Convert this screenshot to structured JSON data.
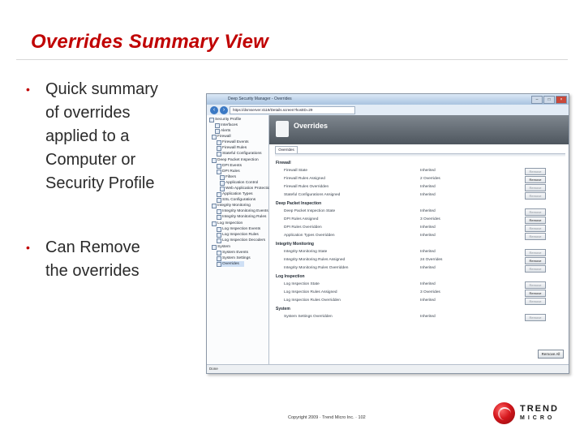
{
  "slide": {
    "title": "Overrides Summary View",
    "bullets": [
      {
        "symbol": "•",
        "text": "Quick summary\nof overrides\napplied to a\nComputer or\nSecurity Profile"
      },
      {
        "symbol": "•",
        "text": "Can Remove\nthe overrides"
      }
    ],
    "footer": "Copyright 2009 · Trend Micro Inc. · 102",
    "logo": {
      "word": "TREND",
      "sub": "MICRO"
    }
  },
  "screenshot": {
    "window_title": "Deep Security Manager - Overrides",
    "address": "https://dsmserver:4119/Details.screen?hostID=29",
    "controls": {
      "minimize": "–",
      "maximize": "□",
      "close": "×"
    },
    "tree": [
      {
        "label": "Security Profile",
        "icon": "profile-icon"
      },
      {
        "label": "Interfaces",
        "icon": "interfaces-icon"
      },
      {
        "label": "Alerts",
        "icon": "alerts-icon"
      },
      {
        "label": "Firewall",
        "icon": "firewall-icon"
      },
      {
        "label": "Firewall Events",
        "icon": "events-icon"
      },
      {
        "label": "Firewall Rules",
        "icon": "rules-icon"
      },
      {
        "label": "Stateful Configurations",
        "icon": "config-icon"
      },
      {
        "label": "Deep Packet Inspection",
        "icon": "dpi-icon"
      },
      {
        "label": "DPI Events",
        "icon": "events-icon"
      },
      {
        "label": "DPI Rules",
        "icon": "rules-icon"
      },
      {
        "label": "Filters",
        "icon": "filter-icon"
      },
      {
        "label": "Application Control",
        "icon": "app-icon"
      },
      {
        "label": "Web Application Protection",
        "icon": "web-icon"
      },
      {
        "label": "Application Types",
        "icon": "types-icon"
      },
      {
        "label": "SSL Configurations",
        "icon": "ssl-icon"
      },
      {
        "label": "Integrity Monitoring",
        "icon": "integrity-icon"
      },
      {
        "label": "Integrity Monitoring Events",
        "icon": "events-icon"
      },
      {
        "label": "Integrity Monitoring Rules",
        "icon": "rules-icon"
      },
      {
        "label": "Log Inspection",
        "icon": "log-icon"
      },
      {
        "label": "Log Inspection Events",
        "icon": "events-icon"
      },
      {
        "label": "Log Inspection Rules",
        "icon": "rules-icon"
      },
      {
        "label": "Log Inspection Decoders",
        "icon": "decoder-icon"
      },
      {
        "label": "System",
        "icon": "system-icon"
      },
      {
        "label": "System Events",
        "icon": "events-icon"
      },
      {
        "label": "System Settings",
        "icon": "settings-icon"
      },
      {
        "label": "Overrides",
        "icon": "overrides-icon"
      }
    ],
    "header_title": "Overrides",
    "tab_label": "Overrides",
    "sections": [
      {
        "title": "Firewall",
        "rows": [
          {
            "name": "Firewall State",
            "status": "Inherited",
            "action": "Remove"
          },
          {
            "name": "Firewall Rules Assigned",
            "status": "2 Overrides",
            "action": "Remove"
          },
          {
            "name": "Firewall Rules Overridden",
            "status": "Inherited",
            "action": "Remove"
          },
          {
            "name": "Stateful Configurations Assigned",
            "status": "Inherited",
            "action": "Remove"
          }
        ]
      },
      {
        "title": "Deep Packet Inspection",
        "rows": [
          {
            "name": "Deep Packet Inspection State",
            "status": "Inherited",
            "action": "Remove"
          },
          {
            "name": "DPI Rules Assigned",
            "status": "3 Overrides",
            "action": "Remove"
          },
          {
            "name": "DPI Rules Overridden",
            "status": "Inherited",
            "action": "Remove"
          },
          {
            "name": "Application Types Overridden",
            "status": "Inherited",
            "action": "Remove"
          }
        ]
      },
      {
        "title": "Integrity Monitoring",
        "rows": [
          {
            "name": "Integrity Monitoring State",
            "status": "Inherited",
            "action": "Remove"
          },
          {
            "name": "Integrity Monitoring Rules Assigned",
            "status": "24 Overrides",
            "action": "Remove"
          },
          {
            "name": "Integrity Monitoring Rules Overridden",
            "status": "Inherited",
            "action": "Remove"
          }
        ]
      },
      {
        "title": "Log Inspection",
        "rows": [
          {
            "name": "Log Inspection State",
            "status": "Inherited",
            "action": "Remove"
          },
          {
            "name": "Log Inspection Rules Assigned",
            "status": "3 Overrides",
            "action": "Remove"
          },
          {
            "name": "Log Inspection Rules Overridden",
            "status": "Inherited",
            "action": "Remove"
          }
        ]
      },
      {
        "title": "System",
        "rows": [
          {
            "name": "System Settings Overridden",
            "status": "Inherited",
            "action": "Remove"
          }
        ]
      }
    ],
    "remove_all_label": "Remove All",
    "status_text": "Done"
  }
}
